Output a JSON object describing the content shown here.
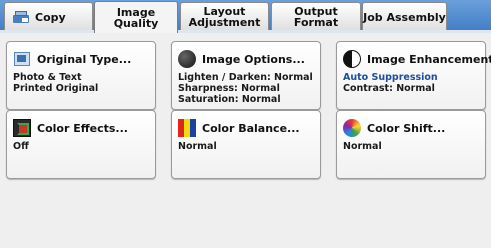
{
  "tabs": [
    {
      "label": "Copy",
      "active": false
    },
    {
      "label": "Image Quality",
      "active": true
    },
    {
      "label": "Layout\nAdjustment",
      "active": false
    },
    {
      "label": "Output Format",
      "active": false
    },
    {
      "label": "Job Assembly",
      "active": false
    }
  ],
  "buttons": {
    "original_type": {
      "title": "Original Type...",
      "lines": [
        "Photo & Text",
        "Printed Original"
      ]
    },
    "image_options": {
      "title": "Image Options...",
      "lines": [
        "Lighten / Darken: Normal",
        "Sharpness: Normal",
        "Saturation: Normal"
      ]
    },
    "image_enhancement": {
      "title": "Image Enhancement...",
      "lines": [
        "Auto Suppression",
        "Contrast: Normal"
      ]
    },
    "color_effects": {
      "title": "Color Effects...",
      "lines": [
        "Off"
      ]
    },
    "color_balance": {
      "title": "Color Balance...",
      "lines": [
        "Normal"
      ]
    },
    "color_shift": {
      "title": "Color Shift...",
      "lines": [
        "Normal"
      ]
    }
  },
  "colors": {
    "tabbar": "#3f7cc6",
    "highlight_text": "#1b4fa0"
  },
  "icons": {
    "copy_tab": "copy-machine-icon",
    "original_type": "document-icon",
    "image_options": "black-circle-icon",
    "image_enhancement": "half-circle-icon",
    "color_effects": "color-effects-icon",
    "color_balance": "color-bars-icon",
    "color_shift": "color-wheel-icon"
  }
}
